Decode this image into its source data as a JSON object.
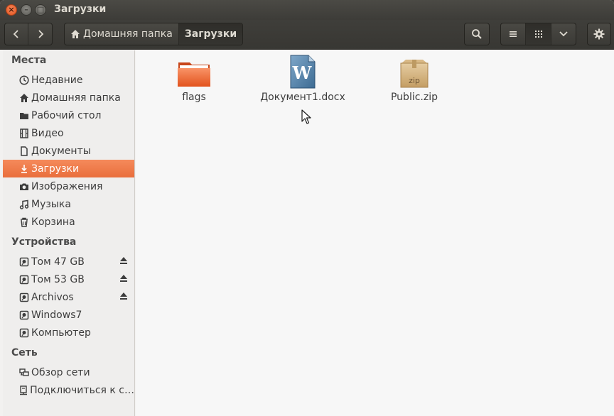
{
  "window": {
    "title": "Загрузки"
  },
  "titlebar": {
    "close_glyph": "×",
    "min_glyph": "–",
    "max_glyph": "□"
  },
  "toolbar": {
    "breadcrumbs": [
      "Домашняя папка",
      "Загрузки"
    ],
    "back_icon": "chevron-left-icon",
    "forward_icon": "chevron-right-icon",
    "search_icon": "search-icon",
    "list_view_icon": "list-icon",
    "grid_view_icon": "grid-icon",
    "options_icon": "chevron-down-icon",
    "settings_icon": "gear-icon"
  },
  "sidebar": {
    "places_title": "Места",
    "places": [
      {
        "label": "Недавние",
        "icon": "clock-icon"
      },
      {
        "label": "Домашняя папка",
        "icon": "home-icon"
      },
      {
        "label": "Рабочий стол",
        "icon": "folder-icon"
      },
      {
        "label": "Видео",
        "icon": "film-icon"
      },
      {
        "label": "Документы",
        "icon": "document-icon"
      },
      {
        "label": "Загрузки",
        "icon": "download-icon",
        "selected": true
      },
      {
        "label": "Изображения",
        "icon": "camera-icon"
      },
      {
        "label": "Музыка",
        "icon": "music-icon"
      },
      {
        "label": "Корзина",
        "icon": "trash-icon"
      }
    ],
    "devices_title": "Устройства",
    "devices": [
      {
        "label": "Том 47 GB",
        "icon": "drive-icon",
        "ejectable": true
      },
      {
        "label": "Том 53 GB",
        "icon": "drive-icon",
        "ejectable": true
      },
      {
        "label": "Archivos",
        "icon": "drive-icon",
        "ejectable": true
      },
      {
        "label": "Windows7",
        "icon": "drive-icon",
        "ejectable": false
      },
      {
        "label": "Компьютер",
        "icon": "drive-icon",
        "ejectable": false
      }
    ],
    "network_title": "Сеть",
    "network": [
      {
        "label": "Обзор сети",
        "icon": "network-icon"
      },
      {
        "label": "Подключиться к с…",
        "icon": "server-icon"
      }
    ]
  },
  "files": [
    {
      "name": "flags",
      "icon": "folder-icon"
    },
    {
      "name": "Документ1.docx",
      "icon": "word-document-icon"
    },
    {
      "name": "Public.zip",
      "icon": "zip-archive-icon",
      "badge": "zip"
    }
  ],
  "colors": {
    "accent": "#e96e3c",
    "titlebar": "#3d3c38",
    "sidebar_bg": "#efeeed",
    "content_bg": "#f7f7f7"
  }
}
